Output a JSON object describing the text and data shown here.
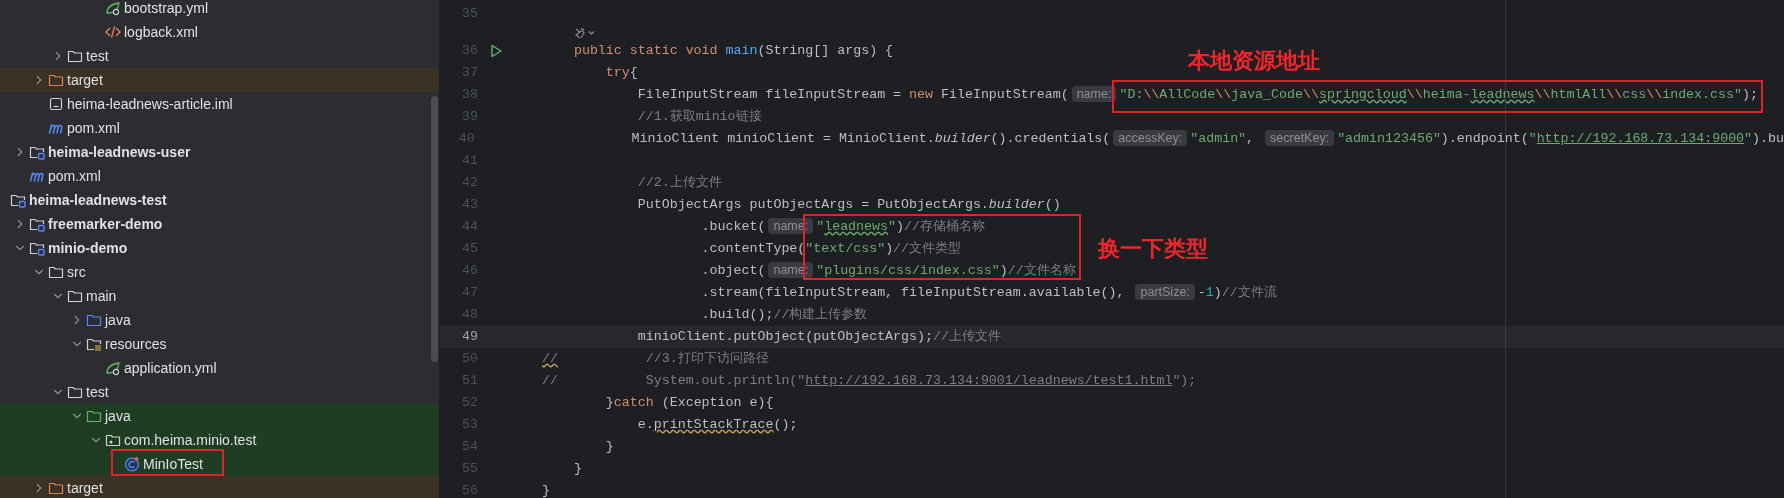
{
  "project_tree": {
    "items": [
      {
        "children": [
          {
            "children": [
              {
                "children": [
                  {
                    "children": [
                      {
                        "children": [
                          {
                            "label": "bootstrap.yml",
                            "kind": "yml"
                          },
                          {
                            "label": "logback.xml",
                            "kind": "xml"
                          }
                        ]
                      }
                    ]
                  },
                  {
                    "label": "test",
                    "kind": "folder",
                    "expanded": false
                  }
                ]
              },
              {
                "label": "target",
                "kind": "excluded-folder",
                "expanded": false,
                "excluded": true
              },
              {
                "label": "heima-leadnews-article.iml",
                "kind": "iml"
              },
              {
                "label": "pom.xml",
                "kind": "maven"
              }
            ]
          },
          {
            "label": "heima-leadnews-user",
            "kind": "module",
            "expanded": false
          },
          {
            "label": "pom.xml",
            "kind": "maven"
          }
        ]
      },
      {
        "label": "heima-leadnews-test",
        "kind": "module",
        "children": [
          {
            "label": "freemarker-demo",
            "kind": "module",
            "expanded": false
          },
          {
            "label": "minio-demo",
            "kind": "module",
            "expanded": true,
            "children": [
              {
                "label": "src",
                "kind": "folder",
                "expanded": true,
                "children": [
                  {
                    "label": "main",
                    "kind": "folder",
                    "expanded": true,
                    "children": [
                      {
                        "label": "java",
                        "kind": "source-folder",
                        "expanded": false
                      },
                      {
                        "label": "resources",
                        "kind": "resources-folder",
                        "expanded": true,
                        "children": [
                          {
                            "label": "application.yml",
                            "kind": "yml"
                          }
                        ]
                      }
                    ]
                  },
                  {
                    "label": "test",
                    "kind": "folder",
                    "expanded": true,
                    "children": [
                      {
                        "label": "java",
                        "kind": "test-folder",
                        "expanded": true,
                        "test_scope": true,
                        "children": [
                          {
                            "label": "com.heima.minio.test",
                            "kind": "package",
                            "expanded": true,
                            "test_scope": true,
                            "children": [
                              {
                                "label": "MinIoTest",
                                "kind": "class",
                                "test_scope": true
                              }
                            ]
                          }
                        ]
                      }
                    ]
                  }
                ]
              },
              {
                "label": "target",
                "kind": "excluded-folder",
                "expanded": false,
                "excluded": true
              }
            ]
          }
        ]
      }
    ]
  },
  "editor": {
    "lines": [
      {
        "kind": "code",
        "number": "35",
        "current": false
      },
      {
        "kind": "inlay"
      },
      {
        "kind": "code",
        "number": "36",
        "current": false,
        "run_marker": true,
        "tokens": [
          {
            "kind": "keyword",
            "text": "    public static void "
          },
          {
            "kind": "func",
            "text": "main"
          },
          {
            "kind": "plain",
            "text": "(String[] args) {"
          }
        ]
      },
      {
        "kind": "code",
        "number": "37",
        "current": false,
        "tokens": [
          {
            "kind": "keyword",
            "text": "        try"
          },
          {
            "kind": "plain",
            "text": "{"
          }
        ]
      },
      {
        "kind": "code",
        "number": "38",
        "current": false,
        "tokens": [
          {
            "kind": "plain",
            "text": "            FileInputStream fileInputStream = "
          },
          {
            "kind": "keyword",
            "text": "new"
          },
          {
            "kind": "plain",
            "text": " FileInputStream("
          },
          {
            "kind": "hint",
            "text": "name:"
          },
          {
            "kind": "string",
            "text": "\"D:"
          },
          {
            "kind": "escape",
            "text": "\\\\"
          },
          {
            "kind": "string",
            "text": "AllCode"
          },
          {
            "kind": "escape",
            "text": "\\\\"
          },
          {
            "kind": "string",
            "text": "java_Code"
          },
          {
            "kind": "escape",
            "text": "\\\\"
          },
          {
            "kind": "typo",
            "text": "springcloud"
          },
          {
            "kind": "escape",
            "text": "\\\\"
          },
          {
            "kind": "string",
            "text": "heima-"
          },
          {
            "kind": "typo",
            "text": "leadnews"
          },
          {
            "kind": "escape",
            "text": "\\\\"
          },
          {
            "kind": "string",
            "text": "htmlAll"
          },
          {
            "kind": "escape",
            "text": "\\\\"
          },
          {
            "kind": "string",
            "text": "css"
          },
          {
            "kind": "escape",
            "text": "\\\\"
          },
          {
            "kind": "string",
            "text": "index.css\""
          },
          {
            "kind": "plain",
            "text": ");"
          }
        ]
      },
      {
        "kind": "code",
        "number": "39",
        "current": false,
        "tokens": [
          {
            "kind": "comment",
            "text": "            //1.获取minio链接"
          }
        ]
      },
      {
        "kind": "code",
        "number": "40",
        "current": false,
        "tokens": [
          {
            "kind": "plain",
            "text": "            MinioClient minioClient = MinioClient."
          },
          {
            "kind": "static-call",
            "text": "builder"
          },
          {
            "kind": "plain",
            "text": "().credentials("
          },
          {
            "kind": "hint",
            "text": "accessKey:"
          },
          {
            "kind": "string",
            "text": "\"admin\""
          },
          {
            "kind": "plain",
            "text": ", "
          },
          {
            "kind": "hint",
            "text": "secretKey:"
          },
          {
            "kind": "string",
            "text": "\"admin123456\""
          },
          {
            "kind": "plain",
            "text": ").endpoint("
          },
          {
            "kind": "string",
            "text": "\""
          },
          {
            "kind": "link",
            "text": "http://192.168.73.134:9000"
          },
          {
            "kind": "string",
            "text": "\""
          },
          {
            "kind": "plain",
            "text": ").bu"
          }
        ]
      },
      {
        "kind": "code",
        "number": "41",
        "current": false
      },
      {
        "kind": "code",
        "number": "42",
        "current": false,
        "tokens": [
          {
            "kind": "comment",
            "text": "            //2.上传文件"
          }
        ]
      },
      {
        "kind": "code",
        "number": "43",
        "current": false,
        "tokens": [
          {
            "kind": "plain",
            "text": "            PutObjectArgs putObjectArgs = PutObjectArgs."
          },
          {
            "kind": "static-call",
            "text": "builder"
          },
          {
            "kind": "plain",
            "text": "()"
          }
        ]
      },
      {
        "kind": "code",
        "number": "44",
        "current": false,
        "tokens": [
          {
            "kind": "plain",
            "text": "                    .bucket("
          },
          {
            "kind": "hint",
            "text": "name:"
          },
          {
            "kind": "string",
            "text": "\""
          },
          {
            "kind": "typo",
            "text": "leadnews"
          },
          {
            "kind": "string",
            "text": "\""
          },
          {
            "kind": "plain",
            "text": ")"
          },
          {
            "kind": "comment",
            "text": "//存储桶名称"
          }
        ]
      },
      {
        "kind": "code",
        "number": "45",
        "current": false,
        "tokens": [
          {
            "kind": "plain",
            "text": "                    .contentType("
          },
          {
            "kind": "string",
            "text": "\"text/css\""
          },
          {
            "kind": "plain",
            "text": ")"
          },
          {
            "kind": "comment",
            "text": "//文件类型"
          }
        ]
      },
      {
        "kind": "code",
        "number": "46",
        "current": false,
        "tokens": [
          {
            "kind": "plain",
            "text": "                    .object("
          },
          {
            "kind": "hint",
            "text": "name:"
          },
          {
            "kind": "string",
            "text": "\"plugins/css/index.css\""
          },
          {
            "kind": "plain",
            "text": ")"
          },
          {
            "kind": "comment",
            "text": "//文件名称"
          }
        ]
      },
      {
        "kind": "code",
        "number": "47",
        "current": false,
        "tokens": [
          {
            "kind": "plain",
            "text": "                    .stream(fileInputStream, fileInputStream.available(), "
          },
          {
            "kind": "hint",
            "text": "partSize:"
          },
          {
            "kind": "plain",
            "text": "-"
          },
          {
            "kind": "number",
            "text": "1"
          },
          {
            "kind": "plain",
            "text": ")"
          },
          {
            "kind": "comment",
            "text": "//文件流"
          }
        ]
      },
      {
        "kind": "code",
        "number": "48",
        "current": false,
        "tokens": [
          {
            "kind": "plain",
            "text": "                    .build();"
          },
          {
            "kind": "comment",
            "text": "//构建上传参数"
          }
        ]
      },
      {
        "kind": "code",
        "number": "49",
        "current": true,
        "tokens": [
          {
            "kind": "plain",
            "text": "            minioClient.putObject(putObjectArgs);"
          },
          {
            "kind": "comment",
            "text": "//上传文件"
          }
        ]
      },
      {
        "kind": "code",
        "number": "50",
        "current": false,
        "tokens": [
          {
            "kind": "comment-warn",
            "text": "//"
          },
          {
            "kind": "comment",
            "text": "           //3.打印下访问路径"
          }
        ]
      },
      {
        "kind": "code",
        "number": "51",
        "current": false,
        "tokens": [
          {
            "kind": "comment",
            "text": "//           System.out.println(\""
          },
          {
            "kind": "comment-link",
            "text": "http://192.168.73.134:9001/leadnews/test1.html"
          },
          {
            "kind": "comment",
            "text": "\");"
          }
        ]
      },
      {
        "kind": "code",
        "number": "52",
        "current": false,
        "tokens": [
          {
            "kind": "plain",
            "text": "        }"
          },
          {
            "kind": "keyword",
            "text": "catch"
          },
          {
            "kind": "plain",
            "text": " (Exception e){"
          }
        ]
      },
      {
        "kind": "code",
        "number": "53",
        "current": false,
        "tokens": [
          {
            "kind": "plain",
            "text": "            e."
          },
          {
            "kind": "warn",
            "text": "printStackTrace"
          },
          {
            "kind": "plain",
            "text": "();"
          }
        ]
      },
      {
        "kind": "code",
        "number": "54",
        "current": false,
        "tokens": [
          {
            "kind": "plain",
            "text": "        }"
          }
        ]
      },
      {
        "kind": "code",
        "number": "55",
        "current": false,
        "tokens": [
          {
            "kind": "plain",
            "text": "    }"
          }
        ]
      },
      {
        "kind": "code",
        "number": "56",
        "current": false,
        "tokens": [
          {
            "kind": "plain",
            "text": "}"
          }
        ]
      }
    ]
  },
  "annotations": [
    {
      "text": "本地资源地址"
    },
    {
      "text": "换一下类型"
    }
  ]
}
